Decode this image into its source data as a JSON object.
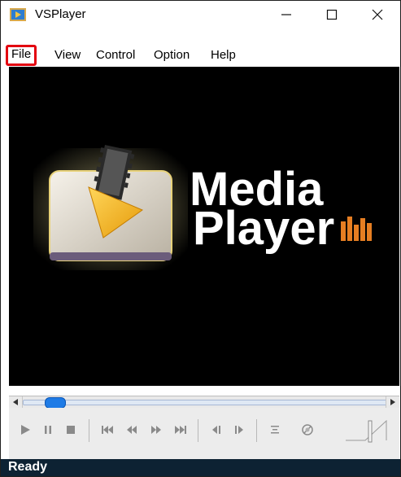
{
  "window": {
    "title": "VSPlayer",
    "controls": {
      "minimize": "—",
      "maximize": "☐",
      "close": "✕"
    }
  },
  "menu": [
    {
      "label": "File",
      "highlighted": true
    },
    {
      "label": "View"
    },
    {
      "label": "Control"
    },
    {
      "label": "Option"
    },
    {
      "label": "Help"
    }
  ],
  "video": {
    "logo_text_line1": "Media",
    "logo_text_line2": "Player",
    "colors": {
      "background": "#000000",
      "play_triangle": "#f2b51c",
      "text": "#ffffff",
      "equalizer": "#e67e22"
    }
  },
  "seek": {
    "position": 0.06
  },
  "controls": [
    {
      "name": "play-icon",
      "glyph": "▶"
    },
    {
      "name": "pause-icon",
      "glyph": "❚❚"
    },
    {
      "name": "stop-icon",
      "glyph": "■"
    },
    {
      "name": "skip-start-icon",
      "glyph": "⏮"
    },
    {
      "name": "rewind-icon",
      "glyph": "⏪"
    },
    {
      "name": "fast-forward-icon",
      "glyph": "⏩"
    },
    {
      "name": "skip-end-icon",
      "glyph": "⏭"
    },
    {
      "name": "frame-back-icon",
      "glyph": "◀❙"
    },
    {
      "name": "frame-forward-icon",
      "glyph": "❙▶"
    },
    {
      "name": "playlist-icon",
      "glyph": "☰"
    },
    {
      "name": "snapshot-icon",
      "glyph": "⊘"
    },
    {
      "name": "volume-slider-icon",
      "glyph": ""
    }
  ],
  "status": {
    "text": "Ready"
  }
}
